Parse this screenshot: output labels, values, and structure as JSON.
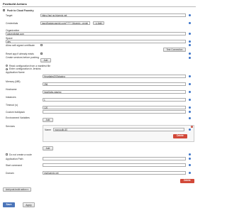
{
  "section": {
    "title": "Postbuild Actions"
  },
  "push": {
    "label": "Push to Cloud Foundry",
    "checked": "✓"
  },
  "fields": {
    "target_label": "Target",
    "target_value": "https://api.ng.bluemix.net",
    "credentials_label": "Credentials",
    "credentials_value": "jasn@apiaryuserid.com/****** (bluemix_creds)",
    "add_label": "Add",
    "organization_label": "Organization",
    "organization_value": "apiarydigital.com",
    "space_label": "Space",
    "space_value": "dev",
    "self_signed_label": "Allow self-signed certificate",
    "test_connection_label": "Test Connection",
    "reset_label": "Reset app if already exists",
    "reset_checked": "✓",
    "create_services_label": "Create services before pushing",
    "create_services_add": "Add",
    "read_manifest_label": "Read configuration from a manifest file",
    "enter_jenkins_label": "Enter configuration in Jenkins",
    "app_name_label": "Application Name",
    "app_name_value": "HeartlabsD02staging",
    "memory_label": "Memory (MB)",
    "memory_value": "256",
    "hostname_label": "Hostname",
    "hostname_value": "heartlabs-staging",
    "instances_label": "Instances",
    "instances_value": "1",
    "timeout_label": "Timeout (s)",
    "timeout_value": "120",
    "custom_buildpack_label": "Custom buildpack",
    "custom_buildpack_value": "",
    "env_vars_label": "Environment Variables",
    "env_vars_add": "Add",
    "services_label": "Services",
    "service_name_label": "Name",
    "service_name_value": "mongodb-60",
    "delete_label": "Delete",
    "add_below_label": "Add",
    "no_route_label": "Do not create a route",
    "app_path_label": "Application Path",
    "app_path_value": "",
    "start_command_label": "Start command",
    "start_command_value": "",
    "domain_label": "Domain",
    "domain_value": "mybluemix.net",
    "delete2_label": "Delete"
  },
  "footer": {
    "add_post_build_label": "Add post-build action",
    "save_label": "Save",
    "apply_label": "Apply"
  },
  "colors": {
    "primary_button": "#4b75b9",
    "delete_button": "#d24939",
    "help_icon": "#3b73c8"
  }
}
